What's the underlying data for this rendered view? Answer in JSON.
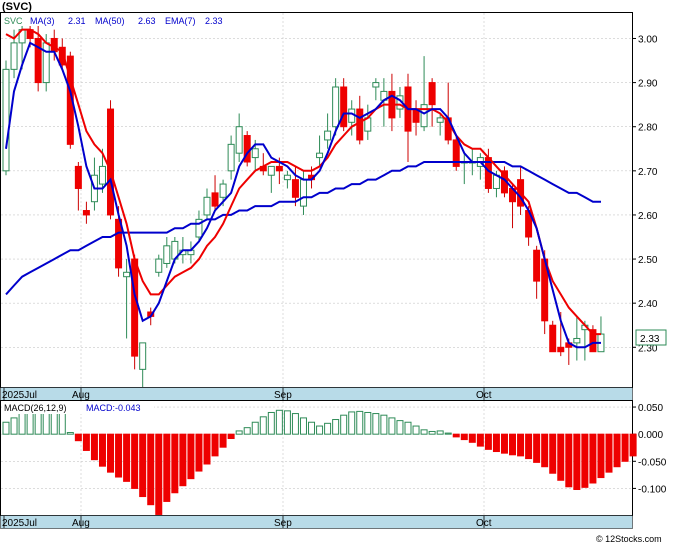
{
  "chart_data": [
    {
      "type": "candlestick",
      "title": "(SVC)",
      "legend": [
        {
          "label": "SVC",
          "color": "#2e8b57"
        },
        {
          "label": "MA(3)",
          "value": "2.31",
          "color": "#0000cc"
        },
        {
          "label": "MA(50)",
          "value": "2.63",
          "color": "#0000cc"
        },
        {
          "label": "EMA(7)",
          "value": "2.33",
          "color": "#0000cc"
        }
      ],
      "y_ticks": [
        "3.00",
        "2.90",
        "2.80",
        "2.70",
        "2.60",
        "2.50",
        "2.40",
        "2.30"
      ],
      "ylim": [
        2.21,
        3.06
      ],
      "last_price": "2.33",
      "x_labels": [
        "2025Jul",
        "Aug",
        "Sep",
        "Oct"
      ],
      "grid": true,
      "candles": [
        [
          2.7,
          2.95,
          2.69,
          2.93
        ],
        [
          2.93,
          3.02,
          2.91,
          2.99
        ],
        [
          2.99,
          3.04,
          2.93,
          3.02
        ],
        [
          3.02,
          3.03,
          2.98,
          3.0
        ],
        [
          3.0,
          3.04,
          2.88,
          2.9
        ],
        [
          2.9,
          3.01,
          2.88,
          2.99
        ],
        [
          3.0,
          3.02,
          2.95,
          2.97
        ],
        [
          2.98,
          3.0,
          2.93,
          2.94
        ],
        [
          2.96,
          2.97,
          2.75,
          2.76
        ],
        [
          2.71,
          2.72,
          2.61,
          2.66
        ],
        [
          2.61,
          2.63,
          2.58,
          2.6
        ],
        [
          2.63,
          2.73,
          2.61,
          2.69
        ],
        [
          2.67,
          2.75,
          2.65,
          2.71
        ],
        [
          2.84,
          2.86,
          2.59,
          2.6
        ],
        [
          2.59,
          2.62,
          2.46,
          2.48
        ],
        [
          2.46,
          2.5,
          2.32,
          2.47
        ],
        [
          2.5,
          2.51,
          2.25,
          2.28
        ],
        [
          2.25,
          2.31,
          2.21,
          2.31
        ],
        [
          2.38,
          2.39,
          2.35,
          2.37
        ],
        [
          2.47,
          2.51,
          2.46,
          2.5
        ],
        [
          2.49,
          2.55,
          2.48,
          2.53
        ],
        [
          2.5,
          2.55,
          2.49,
          2.54
        ],
        [
          2.51,
          2.55,
          2.49,
          2.52
        ],
        [
          2.51,
          2.54,
          2.49,
          2.52
        ],
        [
          2.55,
          2.61,
          2.54,
          2.59
        ],
        [
          2.6,
          2.66,
          2.59,
          2.64
        ],
        [
          2.65,
          2.69,
          2.61,
          2.62
        ],
        [
          2.64,
          2.68,
          2.62,
          2.67
        ],
        [
          2.7,
          2.78,
          2.68,
          2.76
        ],
        [
          2.74,
          2.83,
          2.72,
          2.8
        ],
        [
          2.78,
          2.79,
          2.71,
          2.72
        ],
        [
          2.73,
          2.77,
          2.7,
          2.75
        ],
        [
          2.71,
          2.74,
          2.69,
          2.7
        ],
        [
          2.69,
          2.71,
          2.65,
          2.71
        ],
        [
          2.71,
          2.73,
          2.67,
          2.7
        ],
        [
          2.68,
          2.7,
          2.66,
          2.69
        ],
        [
          2.68,
          2.71,
          2.62,
          2.64
        ],
        [
          2.62,
          2.7,
          2.6,
          2.68
        ],
        [
          2.69,
          2.71,
          2.66,
          2.68
        ],
        [
          2.73,
          2.78,
          2.71,
          2.74
        ],
        [
          2.77,
          2.83,
          2.75,
          2.79
        ],
        [
          2.8,
          2.91,
          2.78,
          2.89
        ],
        [
          2.89,
          2.91,
          2.79,
          2.8
        ],
        [
          2.81,
          2.86,
          2.78,
          2.84
        ],
        [
          2.84,
          2.87,
          2.76,
          2.77
        ],
        [
          2.79,
          2.85,
          2.77,
          2.82
        ],
        [
          2.89,
          2.91,
          2.86,
          2.9
        ],
        [
          2.86,
          2.91,
          2.8,
          2.88
        ],
        [
          2.88,
          2.92,
          2.79,
          2.82
        ],
        [
          2.84,
          2.89,
          2.82,
          2.87
        ],
        [
          2.89,
          2.92,
          2.72,
          2.79
        ],
        [
          2.84,
          2.86,
          2.78,
          2.81
        ],
        [
          2.8,
          2.96,
          2.79,
          2.85
        ],
        [
          2.9,
          2.91,
          2.8,
          2.85
        ],
        [
          2.81,
          2.83,
          2.78,
          2.82
        ],
        [
          2.82,
          2.9,
          2.76,
          2.77
        ],
        [
          2.77,
          2.78,
          2.7,
          2.71
        ],
        [
          2.72,
          2.74,
          2.67,
          2.72
        ],
        [
          2.72,
          2.75,
          2.69,
          2.72
        ],
        [
          2.71,
          2.74,
          2.68,
          2.73
        ],
        [
          2.73,
          2.75,
          2.65,
          2.66
        ],
        [
          2.66,
          2.7,
          2.64,
          2.69
        ],
        [
          2.7,
          2.71,
          2.64,
          2.65
        ],
        [
          2.66,
          2.67,
          2.57,
          2.63
        ],
        [
          2.68,
          2.71,
          2.6,
          2.62
        ],
        [
          2.61,
          2.62,
          2.53,
          2.55
        ],
        [
          2.52,
          2.53,
          2.41,
          2.45
        ],
        [
          2.5,
          2.52,
          2.33,
          2.36
        ],
        [
          2.35,
          2.36,
          2.32,
          2.29
        ],
        [
          2.3,
          2.38,
          2.28,
          2.29
        ],
        [
          2.31,
          2.32,
          2.26,
          2.3
        ],
        [
          2.31,
          2.37,
          2.27,
          2.32
        ],
        [
          2.34,
          2.36,
          2.27,
          2.35
        ],
        [
          2.34,
          2.35,
          2.29,
          2.29
        ],
        [
          2.29,
          2.37,
          2.29,
          2.33
        ]
      ],
      "ma3": [
        2.75,
        2.88,
        2.94,
        2.99,
        2.98,
        2.97,
        2.97,
        2.93,
        2.88,
        2.8,
        2.71,
        2.66,
        2.66,
        2.68,
        2.6,
        2.53,
        2.42,
        2.36,
        2.37,
        2.4,
        2.45,
        2.5,
        2.52,
        2.52,
        2.54,
        2.57,
        2.61,
        2.63,
        2.65,
        2.71,
        2.74,
        2.76,
        2.76,
        2.73,
        2.72,
        2.71,
        2.69,
        2.68,
        2.68,
        2.7,
        2.74,
        2.79,
        2.83,
        2.83,
        2.82,
        2.83,
        2.84,
        2.86,
        2.87,
        2.86,
        2.84,
        2.84,
        2.83,
        2.84,
        2.84,
        2.82,
        2.78,
        2.74,
        2.72,
        2.72,
        2.7,
        2.69,
        2.68,
        2.66,
        2.64,
        2.61,
        2.57,
        2.5,
        2.43,
        2.36,
        2.31,
        2.3,
        2.3,
        2.31,
        2.31
      ],
      "ema7": [
        3.01,
        3.0,
        3.02,
        3.02,
        3.01,
        2.99,
        2.98,
        2.97,
        2.91,
        2.85,
        2.79,
        2.76,
        2.74,
        2.7,
        2.64,
        2.58,
        2.5,
        2.45,
        2.42,
        2.42,
        2.44,
        2.46,
        2.47,
        2.48,
        2.5,
        2.53,
        2.55,
        2.58,
        2.62,
        2.66,
        2.68,
        2.7,
        2.71,
        2.72,
        2.72,
        2.72,
        2.71,
        2.7,
        2.7,
        2.71,
        2.73,
        2.76,
        2.78,
        2.8,
        2.81,
        2.82,
        2.84,
        2.85,
        2.85,
        2.85,
        2.84,
        2.84,
        2.84,
        2.84,
        2.83,
        2.81,
        2.78,
        2.76,
        2.75,
        2.75,
        2.73,
        2.71,
        2.69,
        2.67,
        2.65,
        2.63,
        2.57,
        2.5,
        2.45,
        2.42,
        2.39,
        2.37,
        2.35,
        2.33,
        2.33
      ],
      "ma50": [
        2.42,
        2.44,
        2.46,
        2.47,
        2.48,
        2.49,
        2.5,
        2.51,
        2.52,
        2.52,
        2.53,
        2.54,
        2.55,
        2.55,
        2.56,
        2.56,
        2.56,
        2.56,
        2.56,
        2.56,
        2.56,
        2.57,
        2.57,
        2.58,
        2.58,
        2.59,
        2.59,
        2.6,
        2.6,
        2.61,
        2.61,
        2.62,
        2.62,
        2.62,
        2.63,
        2.63,
        2.63,
        2.64,
        2.64,
        2.65,
        2.65,
        2.66,
        2.66,
        2.67,
        2.67,
        2.68,
        2.68,
        2.69,
        2.7,
        2.7,
        2.71,
        2.71,
        2.72,
        2.72,
        2.72,
        2.72,
        2.72,
        2.72,
        2.72,
        2.72,
        2.72,
        2.72,
        2.72,
        2.71,
        2.71,
        2.7,
        2.69,
        2.68,
        2.67,
        2.66,
        2.65,
        2.65,
        2.64,
        2.63,
        2.63
      ]
    },
    {
      "type": "bar",
      "title": "MACD(26,12,9)",
      "legend_value": "MACD:-0.043",
      "y_ticks": [
        "0.050",
        "0.000",
        "-0.050",
        "-0.100"
      ],
      "ylim": [
        -0.149,
        0.063
      ],
      "x_labels": [
        "2025Jul",
        "Aug",
        "Sep",
        "Oct"
      ],
      "values": [
        0.022,
        0.03,
        0.04,
        0.046,
        0.05,
        0.053,
        0.046,
        0.04,
        0.003,
        -0.012,
        -0.03,
        -0.047,
        -0.059,
        -0.07,
        -0.079,
        -0.087,
        -0.1,
        -0.115,
        -0.13,
        -0.148,
        -0.124,
        -0.108,
        -0.095,
        -0.082,
        -0.068,
        -0.055,
        -0.04,
        -0.024,
        -0.008,
        0.006,
        0.012,
        0.022,
        0.032,
        0.04,
        0.044,
        0.043,
        0.038,
        0.03,
        0.022,
        0.015,
        0.02,
        0.027,
        0.035,
        0.041,
        0.042,
        0.04,
        0.038,
        0.035,
        0.03,
        0.025,
        0.022,
        0.015,
        0.008,
        0.005,
        0.006,
        0.002,
        -0.005,
        -0.01,
        -0.015,
        -0.022,
        -0.028,
        -0.032,
        -0.035,
        -0.038,
        -0.04,
        -0.045,
        -0.052,
        -0.06,
        -0.072,
        -0.085,
        -0.097,
        -0.102,
        -0.098,
        -0.09,
        -0.08,
        -0.07,
        -0.06,
        -0.05,
        -0.04
      ]
    }
  ],
  "watermark": "© 12Stocks.com"
}
